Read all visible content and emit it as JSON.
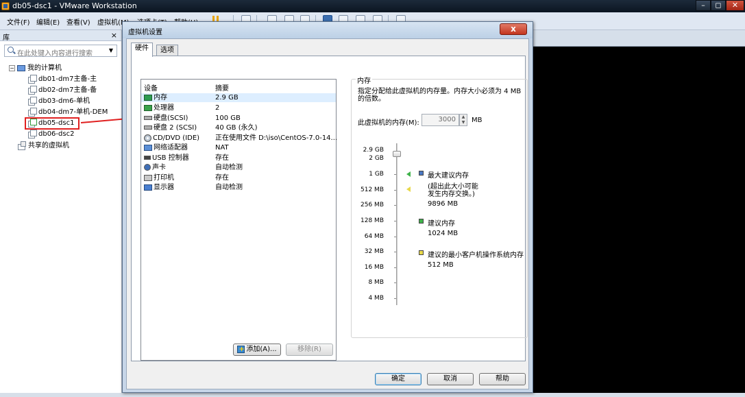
{
  "window": {
    "title": "db05-dsc1 - VMware Workstation",
    "minimize": "–",
    "maximize": "◻",
    "close": "✕"
  },
  "menu": {
    "file": "文件(F)",
    "edit": "编辑(E)",
    "view": "查看(V)",
    "vm": "虚拟机(M)",
    "tabs": "选项卡(T)",
    "help": "帮助(H)"
  },
  "library": {
    "title": "库",
    "close": "×",
    "search_placeholder": "在此处键入内容进行搜索",
    "tree": {
      "my_computer": "我的计算机",
      "vms": [
        "db01-dm7主备-主",
        "db02-dm7主备-备",
        "db03-dm6-单机",
        "db04-dm7-单机-DEM",
        "db05-dsc1",
        "db06-dsc2"
      ],
      "shared": "共享的虚拟机"
    }
  },
  "dialog": {
    "title": "虚拟机设置",
    "close": "x",
    "tabs": {
      "hardware": "硬件",
      "options": "选项"
    },
    "columns": {
      "device": "设备",
      "summary": "摘要"
    },
    "devices": [
      {
        "name": "内存",
        "summary": "2.9 GB",
        "icon": "memory-icon"
      },
      {
        "name": "处理器",
        "summary": "2",
        "icon": "cpu-icon"
      },
      {
        "name": "硬盘(SCSI)",
        "summary": "100 GB",
        "icon": "hard-disk-icon"
      },
      {
        "name": "硬盘 2 (SCSI)",
        "summary": "40 GB (永久)",
        "icon": "hard-disk-icon"
      },
      {
        "name": "CD/DVD (IDE)",
        "summary": "正在使用文件 D:\\iso\\CentOS-7.0-14...",
        "icon": "cd-dvd-icon"
      },
      {
        "name": "网络适配器",
        "summary": "NAT",
        "icon": "network-adapter-icon"
      },
      {
        "name": "USB 控制器",
        "summary": "存在",
        "icon": "usb-icon"
      },
      {
        "name": "声卡",
        "summary": "自动检测",
        "icon": "sound-card-icon"
      },
      {
        "name": "打印机",
        "summary": "存在",
        "icon": "printer-icon"
      },
      {
        "name": "显示器",
        "summary": "自动检测",
        "icon": "display-icon"
      }
    ],
    "add_button": "添加(A)...",
    "remove_button": "移除(R)",
    "ok_button": "确定",
    "cancel_button": "取消",
    "help_button": "帮助",
    "memory": {
      "group_title": "内存",
      "description": "指定分配给此虚拟机的内存量。内存大小必须为 4 MB 的倍数。",
      "label": "此虚拟机的内存(M):",
      "value": "3000",
      "unit": "MB",
      "scale": [
        "2.9 GB",
        "2 GB",
        "1 GB",
        "512 MB",
        "256 MB",
        "128 MB",
        "64 MB",
        "32 MB",
        "16 MB",
        "8 MB",
        "4 MB"
      ],
      "legend": {
        "max_title": "最大建议内存",
        "max_note_line1": "(超出此大小可能",
        "max_note_line2": "发生内存交换。)",
        "max_value": "9896 MB",
        "rec_title": "建议内存",
        "rec_value": "1024 MB",
        "min_title": "建议的最小客户机操作系统内存",
        "min_value": "512 MB"
      },
      "colors": {
        "max": "#4a78c2",
        "recommended": "#3fb24a",
        "minimum": "#e8d84a"
      }
    }
  }
}
